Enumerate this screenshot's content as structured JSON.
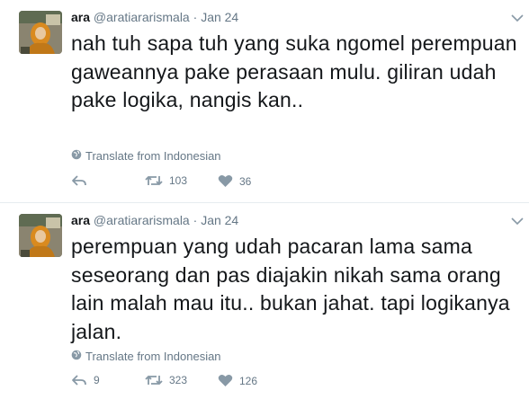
{
  "tweets": [
    {
      "name": "ara",
      "handle": "@aratiararismala",
      "separator": "·",
      "time": "Jan 24",
      "text": "nah tuh sapa tuh yang suka ngomel perempuan gaweannya pake perasaan mulu. giliran udah pake logika, nangis kan..",
      "translate_label": "Translate from Indonesian",
      "replies": "",
      "retweets": "103",
      "likes": "36"
    },
    {
      "name": "ara",
      "handle": "@aratiararismala",
      "separator": "·",
      "time": "Jan 24",
      "text": "perempuan yang udah pacaran lama sama seseorang dan pas diajakin nikah sama orang lain malah mau itu.. bukan jahat. tapi logikanya jalan.",
      "translate_label": "Translate from Indonesian",
      "replies": "9",
      "retweets": "323",
      "likes": "126"
    }
  ],
  "colors": {
    "text": "#14171a",
    "muted": "#657786",
    "divider": "#e6ecf0"
  },
  "icons": {
    "reply": "reply-icon",
    "retweet": "retweet-icon",
    "like": "heart-icon",
    "translate": "globe-icon",
    "more": "chevron-down-icon"
  }
}
